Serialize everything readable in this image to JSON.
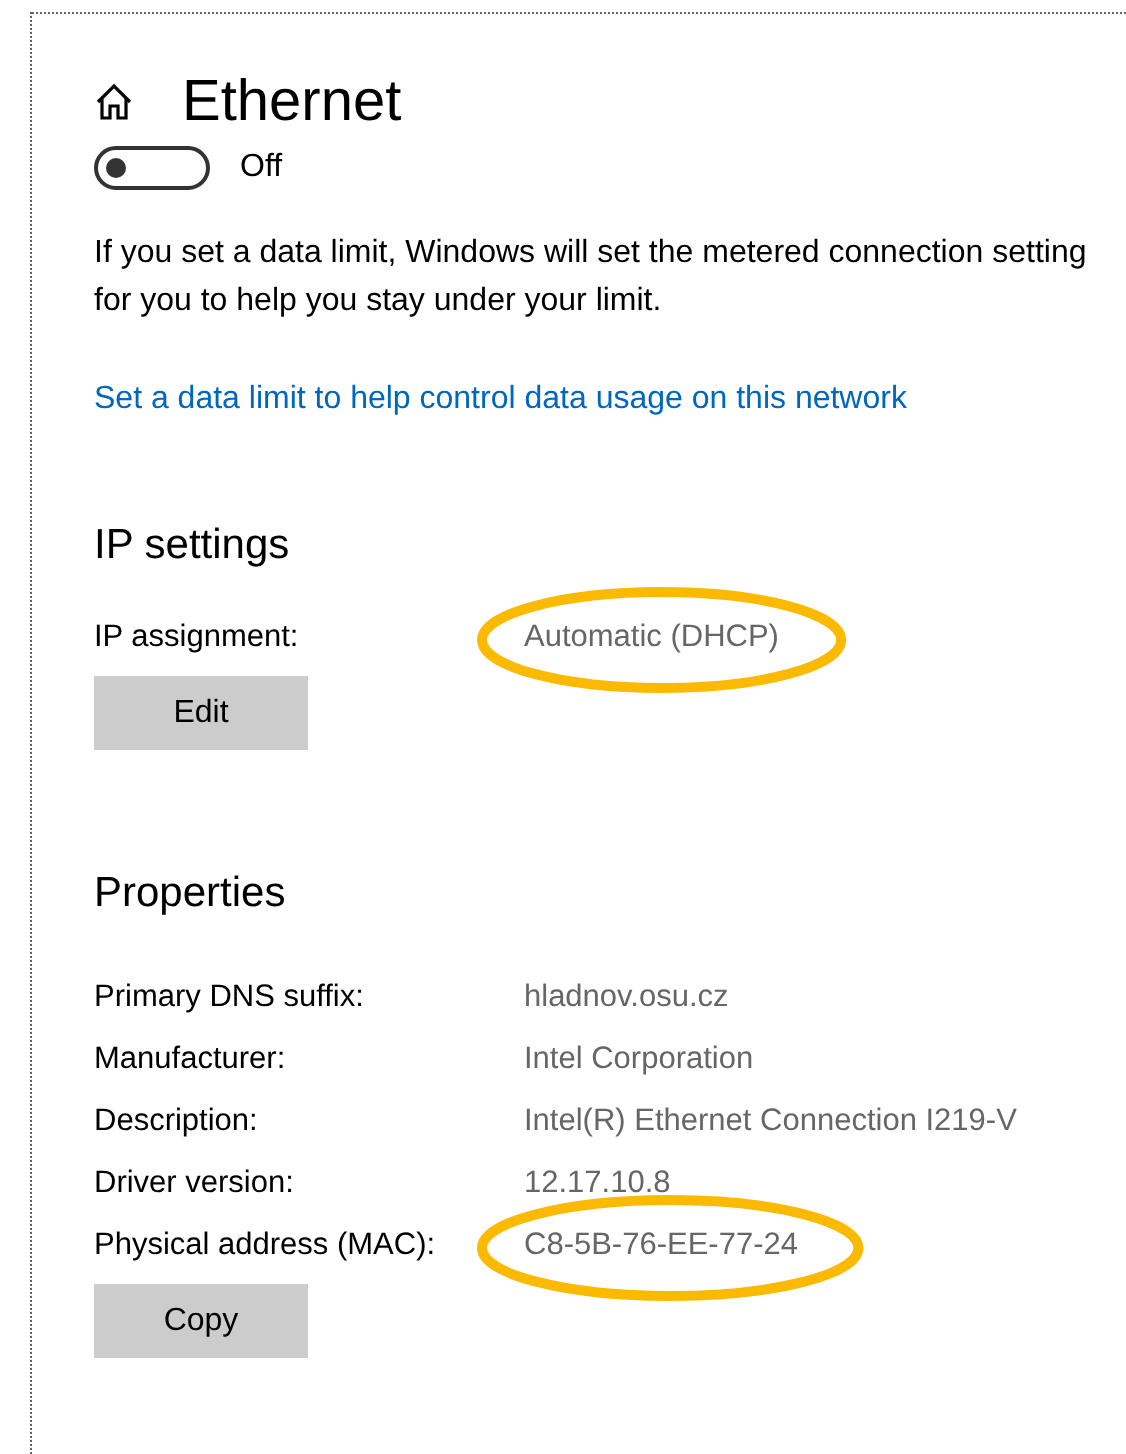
{
  "header": {
    "title": "Ethernet"
  },
  "metered_toggle": {
    "on": false,
    "label": "Off"
  },
  "data_limit_note": "If you set a data limit, Windows will set the metered connection setting for you to help you stay under your limit.",
  "data_limit_link": "Set a data limit to help control data usage on this network",
  "ip_settings": {
    "heading": "IP settings",
    "rows": [
      {
        "label": "IP assignment:",
        "value": "Automatic (DHCP)",
        "highlighted": true
      }
    ],
    "button": "Edit"
  },
  "properties": {
    "heading": "Properties",
    "rows": [
      {
        "label": "Primary DNS suffix:",
        "value": "hladnov.osu.cz",
        "highlighted": false
      },
      {
        "label": "Manufacturer:",
        "value": "Intel Corporation",
        "highlighted": false
      },
      {
        "label": "Description:",
        "value": "Intel(R) Ethernet Connection I219-V",
        "highlighted": false
      },
      {
        "label": "Driver version:",
        "value": "12.17.10.8",
        "highlighted": false
      },
      {
        "label": "Physical address (MAC):",
        "value": "C8-5B-76-EE-77-24",
        "highlighted": true
      }
    ],
    "button": "Copy"
  }
}
